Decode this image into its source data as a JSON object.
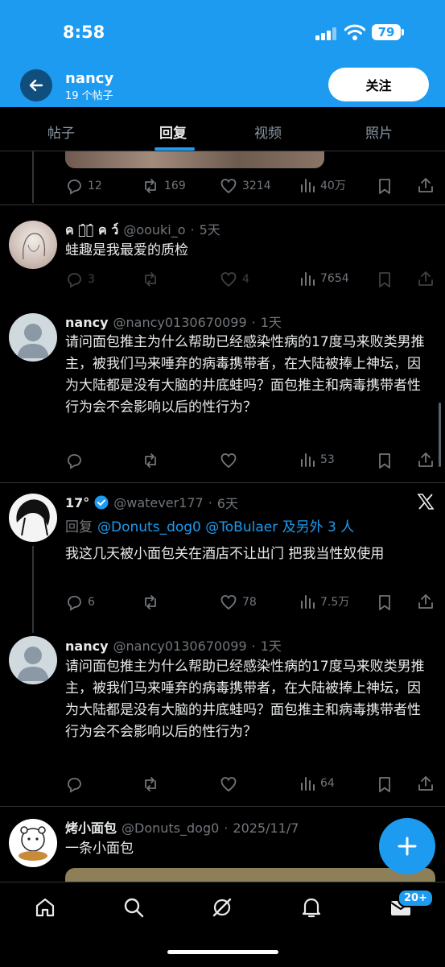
{
  "status": {
    "time": "8:58",
    "battery": "79"
  },
  "header": {
    "name": "nancy",
    "post_count": "19 个帖子",
    "follow_label": "关注"
  },
  "tabs": [
    "帖子",
    "回复",
    "视频",
    "照片"
  ],
  "posts": [
    {
      "id": "top",
      "stats": {
        "replies": "12",
        "reposts": "169",
        "likes": "3214",
        "views": "40万"
      }
    },
    {
      "name": "ค ร̂ร̂ ค ว์",
      "handle": "@oouki_o",
      "time": "5天",
      "text": "蛙趣是我最爱的质检",
      "stats": {
        "replies": "3",
        "reposts": "",
        "likes": "4",
        "views": "7654"
      }
    },
    {
      "name": "nancy",
      "handle": "@nancy0130670099",
      "time": "1天",
      "text": "请问面包推主为什么帮助已经感染性病的17度马来败类男推主，被我们马来唾弃的病毒携带者，在大陆被捧上神坛，因为大陆都是没有大脑的井底蛙吗？面包推主和病毒携带者性行为会不会影响以后的性行为？",
      "stats": {
        "replies": "",
        "reposts": "",
        "likes": "",
        "views": "53"
      }
    },
    {
      "name": "17°",
      "handle": "@watever177",
      "time": "6天",
      "reply_prefix": "回复",
      "reply_to": "@Donuts_dog0 @ToBulaer 及另外 3 人",
      "text": "我这几天被小面包关在酒店不让出门 把我当性奴使用",
      "stats": {
        "replies": "6",
        "reposts": "",
        "likes": "78",
        "views": "7.5万"
      }
    },
    {
      "name": "nancy",
      "handle": "@nancy0130670099",
      "time": "1天",
      "text": "请问面包推主为什么帮助已经感染性病的17度马来败类男推主，被我们马来唾弃的病毒携带者，在大陆被捧上神坛，因为大陆都是没有大脑的井底蛙吗？面包推主和病毒携带者性行为会不会影响以后的性行为？",
      "stats": {
        "replies": "",
        "reposts": "",
        "likes": "",
        "views": "64"
      }
    },
    {
      "name": "烤小面包",
      "handle": "@Donuts_dog0",
      "time": "2025/11/7",
      "text": "一条小面包"
    }
  ],
  "nav": {
    "badge": "20+"
  },
  "colors": {
    "accent": "#1d9bf0",
    "background": "#000000",
    "muted": "#71767b"
  }
}
